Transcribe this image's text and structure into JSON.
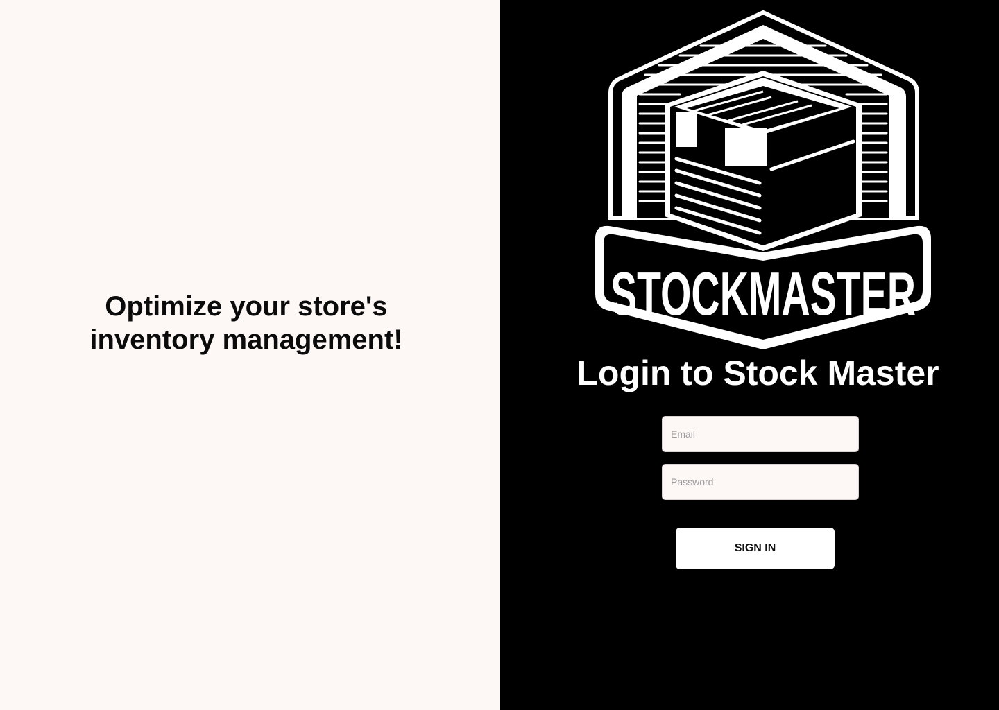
{
  "tagline": {
    "line1": "Optimize your store's",
    "line2": "inventory management!"
  },
  "logo": {
    "brand_text": "STOCKMASTER",
    "icon": "box-icon"
  },
  "login": {
    "title": "Login to Stock Master",
    "email_placeholder": "Email",
    "password_placeholder": "Password",
    "submit_label": "SIGN IN"
  },
  "colors": {
    "left_background": "#fdf7f6",
    "right_background": "#000000",
    "text_dark": "#0b0b0b",
    "text_light": "#ffffff"
  }
}
